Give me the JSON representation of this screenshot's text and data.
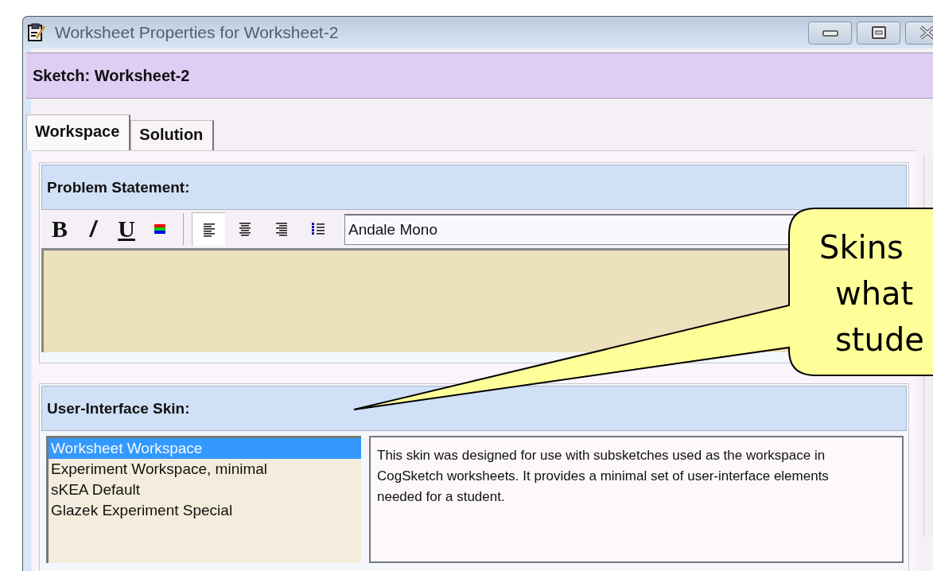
{
  "window": {
    "title": "Worksheet Properties for Worksheet-2"
  },
  "sketch_header": "Sketch: Worksheet-2",
  "tabs": [
    {
      "label": "Workspace",
      "selected": true
    },
    {
      "label": "Solution",
      "selected": false
    }
  ],
  "problem_statement": {
    "heading": "Problem Statement:",
    "format_buttons": [
      {
        "kind": "bold",
        "label": "B"
      },
      {
        "kind": "italic",
        "label": "/"
      },
      {
        "kind": "underline",
        "label": "U"
      },
      {
        "kind": "color"
      }
    ],
    "align_buttons": [
      {
        "kind": "left",
        "selected": true
      },
      {
        "kind": "center",
        "selected": false
      },
      {
        "kind": "right",
        "selected": false
      },
      {
        "kind": "bullets",
        "selected": false
      }
    ],
    "font": "Andale Mono"
  },
  "skin": {
    "heading": "User-Interface Skin:",
    "items": [
      {
        "label": "Worksheet Workspace",
        "selected": true
      },
      {
        "label": "Experiment Workspace, minimal",
        "selected": false
      },
      {
        "label": "sKEA Default",
        "selected": false
      },
      {
        "label": "Glazek Experiment Special",
        "selected": false
      }
    ],
    "description": "This skin was designed for use with subsketches used as the workspace in CogSketch worksheets. It provides a minimal set of user-interface elements needed for a student."
  },
  "callout": {
    "lines": [
      "Skins",
      "what",
      "stude"
    ]
  }
}
